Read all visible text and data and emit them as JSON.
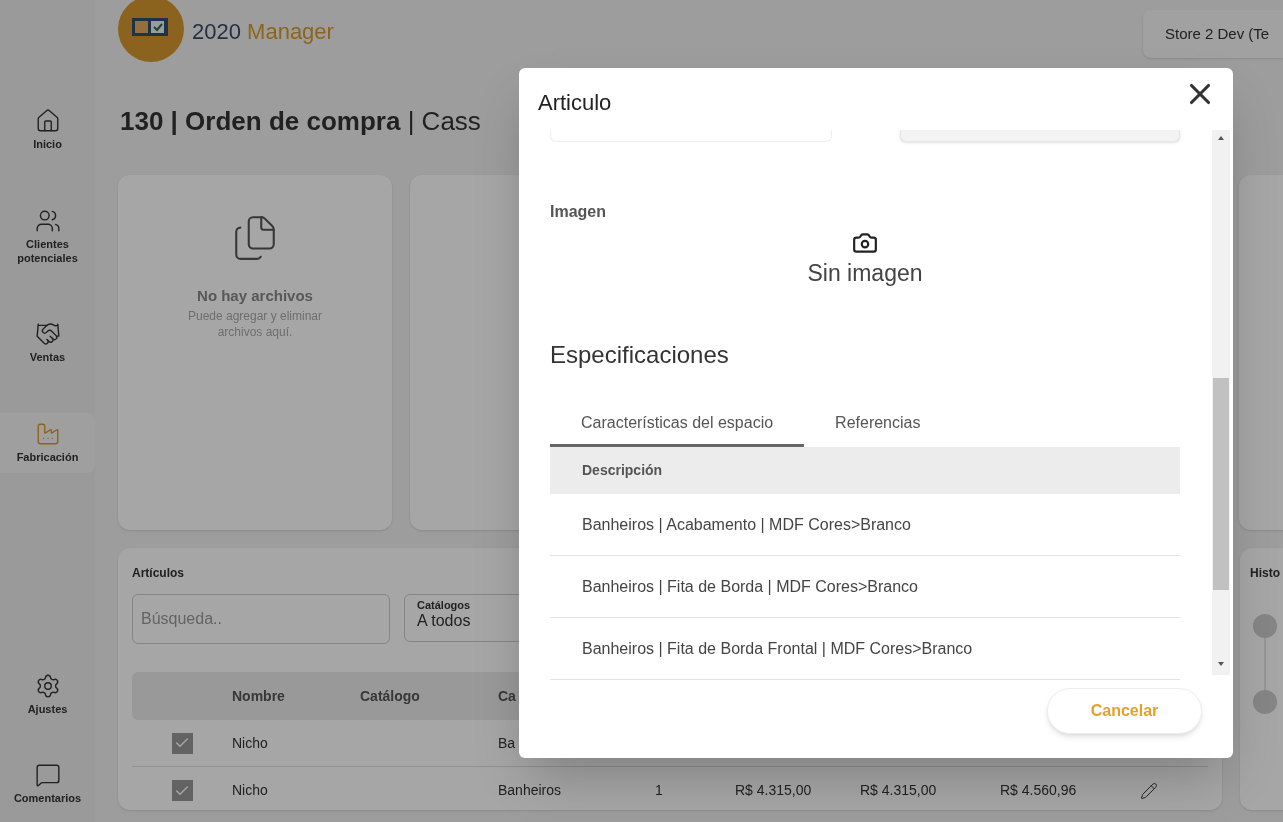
{
  "sidebar": {
    "items": [
      {
        "label": "Inicio",
        "selected": false
      },
      {
        "label": "Clientes potenciales",
        "selected": false
      },
      {
        "label": "Ventas",
        "selected": false
      },
      {
        "label": "Fabricación",
        "selected": true
      }
    ],
    "bottom_items": [
      {
        "label": "Ajustes",
        "selected": false
      },
      {
        "label": "Comentarios",
        "selected": false
      }
    ]
  },
  "header": {
    "logo_text": "2020",
    "logo_word": "Manager",
    "store_button": "Store 2 Dev (Te"
  },
  "page_title": {
    "bold_part": "130 | Orden de compra",
    "rest": "| Cass"
  },
  "files_card": {
    "title": "No hay archivos",
    "text": "Puede agregar y eliminar archivos aquí."
  },
  "articles": {
    "title": "Artículos",
    "search": {
      "placeholder": "Búsqueda.."
    },
    "catalog_select": {
      "label": "Catálogos",
      "value": "A todos"
    },
    "columns": [
      "Nombre",
      "Catálogo",
      "Ca"
    ],
    "rows": [
      {
        "checked": true,
        "name": "Nicho",
        "category": "Ba"
      },
      {
        "checked": true,
        "name": "Nicho",
        "category": "Banheiros",
        "column_5": "1",
        "column_6": "R$ 4.315,00",
        "column_7": "R$ 4.315,00",
        "column_8": "R$ 4.560,96",
        "editable": true
      }
    ]
  },
  "history": {
    "title": "Histo"
  },
  "dialog": {
    "title": "Articulo",
    "image_label": "Imagen",
    "no_image": "Sin imagen",
    "specs_title": "Especificaciones",
    "tabs": [
      {
        "label": "Características del espacio",
        "selected": true
      },
      {
        "label": "Referencias",
        "selected": false
      }
    ],
    "table": {
      "column": "Descripción",
      "rows": [
        "Banheiros | Acabamento | MDF Cores>Branco",
        "Banheiros | Fita de Borda | MDF Cores>Branco",
        "Banheiros | Fita de Borda Frontal | MDF Cores>Branco"
      ]
    },
    "buttons": [
      "Cancelar"
    ]
  }
}
